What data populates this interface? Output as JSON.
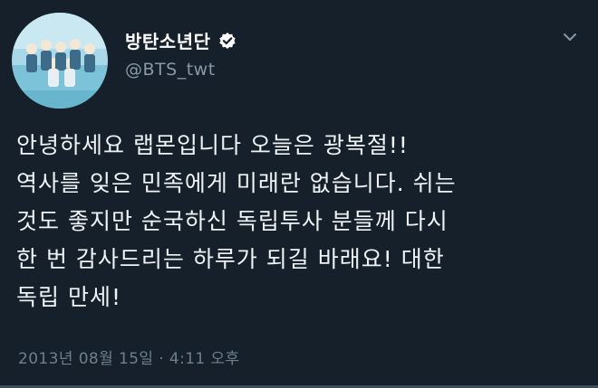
{
  "tweet": {
    "display_name": "방탄소년단",
    "handle": "@BTS_twt",
    "verified_icon": "verified-badge-icon",
    "menu_icon": "chevron-down-icon",
    "text_lines": [
      "안녕하세요 랩몬입니다 오늘은 광복절!!",
      "역사를 잊은 민족에게 미래란 없습니다. 쉬는",
      "것도 좋지만 순국하신 독립투사 분들께 다시",
      "한 번 감사드리는 하루가 되길 바래요! 대한",
      "독립 만세!"
    ],
    "timestamp": "2013년 08월 15일 · 4:11 오후"
  },
  "colors": {
    "background": "#15202b",
    "text": "#eef3f6",
    "muted": "#8899a6"
  }
}
